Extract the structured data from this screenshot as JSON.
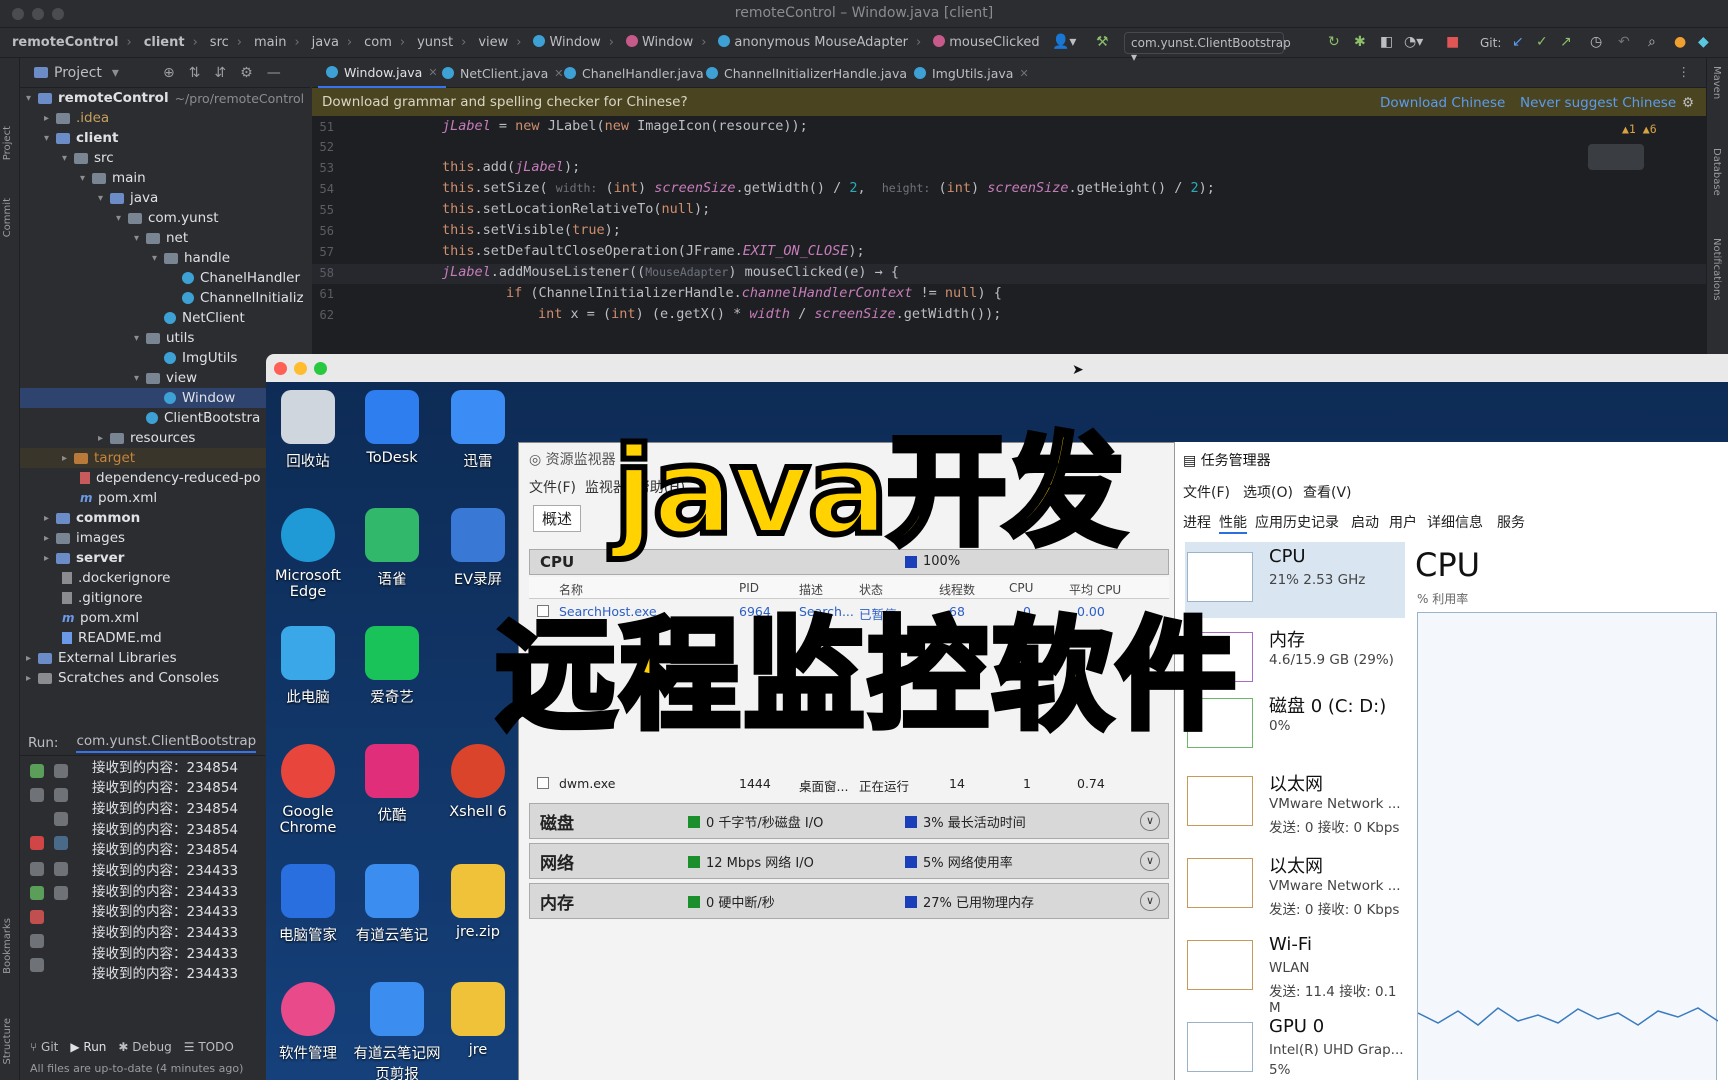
{
  "window": {
    "title": "remoteControl – Window.java [client]"
  },
  "breadcrumbs": [
    "remoteControl",
    "client",
    "src",
    "main",
    "java",
    "com",
    "yunst",
    "view",
    "Window",
    "Window",
    "anonymous MouseAdapter",
    "mouseClicked"
  ],
  "toolbar": {
    "run_config": "com.yunst.ClientBootstrap",
    "git_label": "Git:"
  },
  "project_panel": {
    "title": "Project"
  },
  "tree": [
    {
      "label": "remoteControl",
      "extra": "~/pro/remoteControl"
    },
    {
      "label": ".idea"
    },
    {
      "label": "client"
    },
    {
      "label": "src"
    },
    {
      "label": "main"
    },
    {
      "label": "java"
    },
    {
      "label": "com.yunst"
    },
    {
      "label": "net"
    },
    {
      "label": "handle"
    },
    {
      "label": "ChanelHandler"
    },
    {
      "label": "ChannelInitializ"
    },
    {
      "label": "NetClient"
    },
    {
      "label": "utils"
    },
    {
      "label": "ImgUtils"
    },
    {
      "label": "view"
    },
    {
      "label": "Window"
    },
    {
      "label": "ClientBootstra"
    },
    {
      "label": "resources"
    },
    {
      "label": "target"
    },
    {
      "label": "dependency-reduced-po"
    },
    {
      "label": "pom.xml"
    },
    {
      "label": "common"
    },
    {
      "label": "images"
    },
    {
      "label": "server"
    },
    {
      "label": ".dockerignore"
    },
    {
      "label": ".gitignore"
    },
    {
      "label": "pom.xml"
    },
    {
      "label": "README.md"
    },
    {
      "label": "External Libraries"
    },
    {
      "label": "Scratches and Consoles"
    }
  ],
  "tabs": [
    "Window.java",
    "NetClient.java",
    "ChanelHandler.java",
    "ChannelInitializerHandle.java",
    "ImgUtils.java"
  ],
  "banner": {
    "text": "Download grammar and spelling checker for Chinese?",
    "action1": "Download Chinese",
    "action2": "Never suggest Chinese"
  },
  "editor": {
    "warnings": "▲1 ▲6",
    "lines": [
      {
        "n": "51"
      },
      {
        "n": "52"
      },
      {
        "n": "53"
      },
      {
        "n": "54"
      },
      {
        "n": "55"
      },
      {
        "n": "56"
      },
      {
        "n": "57"
      },
      {
        "n": "58"
      },
      {
        "n": "61"
      },
      {
        "n": "62"
      }
    ]
  },
  "run": {
    "label": "Run:",
    "config": "com.yunst.ClientBootstrap",
    "console": [
      "接收到的内容：234854",
      "接收到的内容：234854",
      "接收到的内容：234854",
      "接收到的内容：234854",
      "接收到的内容：234854",
      "接收到的内容：234433",
      "接收到的内容：234433",
      "接收到的内容：234433",
      "接收到的内容：234433",
      "接收到的内容：234433",
      "接收到的内容：234433"
    ]
  },
  "bottom_tabs": [
    "Git",
    "Run",
    "Debug",
    "TODO"
  ],
  "status": "All files are up-to-date (4 minutes ago)",
  "desktop_icons": [
    {
      "label": "回收站",
      "color": "#d0d6de"
    },
    {
      "label": "ToDesk",
      "color": "#2e7ef0"
    },
    {
      "label": "迅雷",
      "color": "#3b8cf5"
    },
    {
      "label": "Microsoft Edge",
      "color": "#1f9ad6"
    },
    {
      "label": "语雀",
      "color": "#32b86a"
    },
    {
      "label": "EV录屏",
      "color": "#3a78d6"
    },
    {
      "label": "此电脑",
      "color": "#3aa7e8"
    },
    {
      "label": "爱奇艺",
      "color": "#19c35a"
    },
    {
      "label": "Google Chrome",
      "color": "#e8453c"
    },
    {
      "label": "优酷",
      "color": "#e02e7a"
    },
    {
      "label": "Xshell 6",
      "color": "#d9442a"
    },
    {
      "label": "电脑管家",
      "color": "#2a6fe0"
    },
    {
      "label": "有道云笔记",
      "color": "#3c8df0"
    },
    {
      "label": "jre.zip",
      "color": "#f0c23a"
    },
    {
      "label": "软件管理",
      "color": "#e84a8a"
    },
    {
      "label": "有道云笔记网页剪报",
      "color": "#3c8df0"
    },
    {
      "label": "jre",
      "color": "#f0c23a"
    }
  ],
  "resmon": {
    "title": "资源监视器",
    "menu": [
      "文件(F)",
      "监视器",
      "帮助(H)"
    ],
    "overview": "概述",
    "cpu_label": "CPU",
    "cpu_pct": "100%",
    "cols": [
      "名称",
      "PID",
      "描述",
      "状态",
      "线程数",
      "CPU",
      "平均 CPU"
    ],
    "row1": [
      "SearchHost.exe",
      "6964",
      "Search...",
      "已暂停",
      "68",
      "0",
      "0.00"
    ],
    "row2": [
      "dwm.exe",
      "1444",
      "桌面窗...",
      "正在运行",
      "14",
      "1",
      "0.74"
    ],
    "sections": [
      {
        "name": "磁盘",
        "t1": "0 千字节/秒磁盘 I/O",
        "t2": "3% 最长活动时间"
      },
      {
        "name": "网络",
        "t1": "12 Mbps 网络 I/O",
        "t2": "5% 网络使用率"
      },
      {
        "name": "内存",
        "t1": "0 硬中断/秒",
        "t2": "27% 已用物理内存"
      }
    ]
  },
  "taskmgr": {
    "title": "任务管理器",
    "menu": [
      "文件(F)",
      "选项(O)",
      "查看(V)"
    ],
    "tabs": [
      "进程",
      "性能",
      "应用历史记录",
      "启动",
      "用户",
      "详细信息",
      "服务"
    ],
    "perf": [
      {
        "name": "CPU",
        "line1": "21% 2.53 GHz",
        "line2": ""
      },
      {
        "name": "内存",
        "line1": "4.6/15.9 GB (29%)",
        "line2": ""
      },
      {
        "name": "磁盘 0 (C: D:)",
        "line1": "0%",
        "line2": ""
      },
      {
        "name": "以太网",
        "line1": "VMware Network ...",
        "line2": "发送: 0 接收: 0 Kbps"
      },
      {
        "name": "以太网",
        "line1": "VMware Network ...",
        "line2": "发送: 0 接收: 0 Kbps"
      },
      {
        "name": "Wi-Fi",
        "line1": "WLAN",
        "line2": "发送: 11.4 接收: 0.1 M"
      },
      {
        "name": "GPU 0",
        "line1": "Intel(R) UHD Grap...",
        "line2": "5%"
      }
    ],
    "detail_title": "CPU",
    "detail_sub": "% 利用率"
  },
  "overlay": {
    "line1": "java开发",
    "line2": "远程监控软件"
  }
}
